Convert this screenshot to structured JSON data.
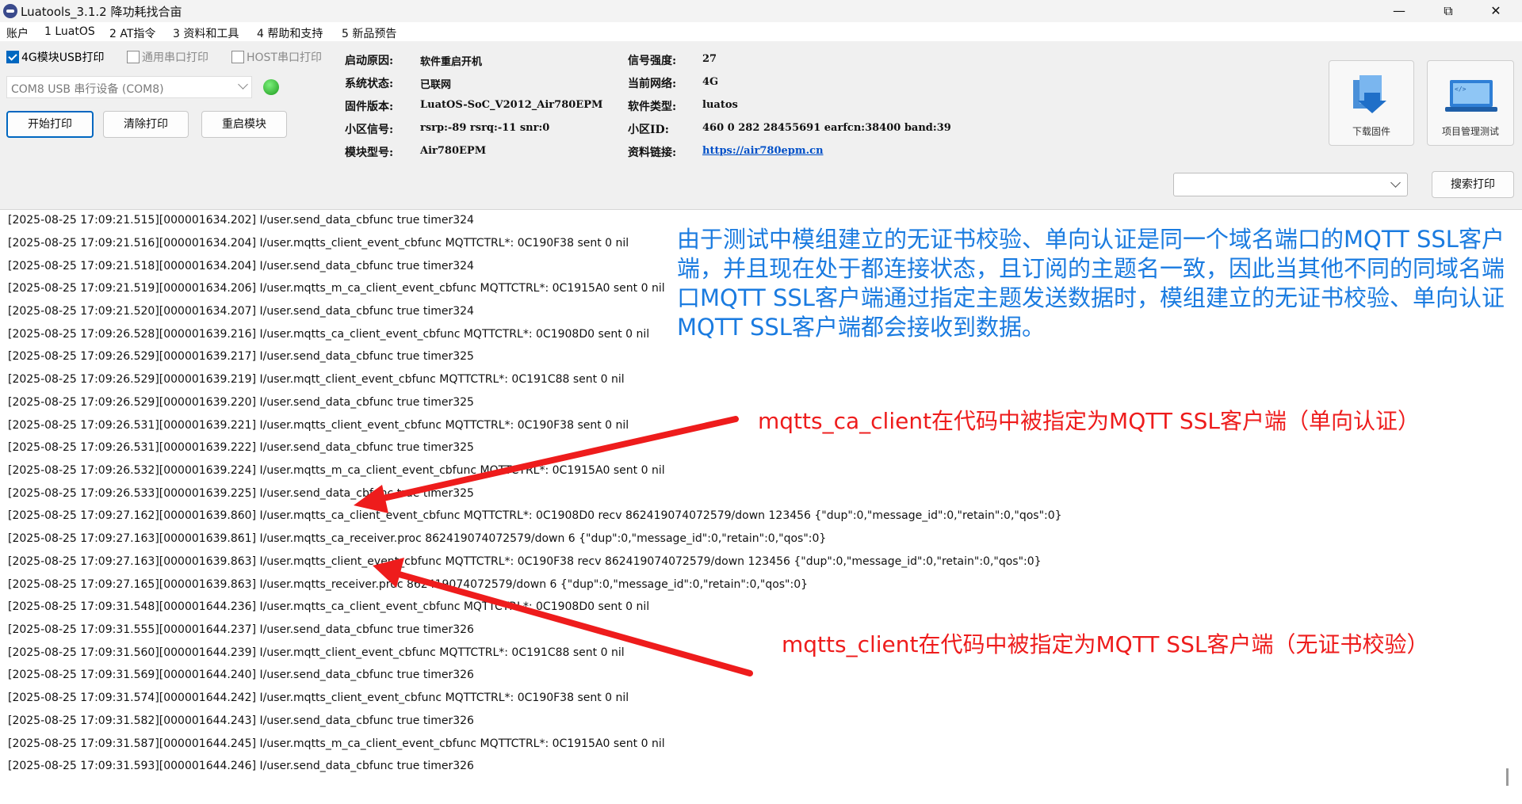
{
  "window": {
    "title": "Luatools_3.1.2 降功耗找合亩",
    "minimize": "—",
    "maximize": "⧉",
    "close": "✕"
  },
  "menu": [
    "账户",
    "1 LuatOS",
    "2 AT指令",
    "3 资料和工具",
    "4 帮助和支持",
    "5 新品预告"
  ],
  "options": {
    "usb_print": {
      "label": "4G模块USB打印",
      "checked": true
    },
    "general_serial": {
      "label": "通用串口打印",
      "checked": false
    },
    "host_serial": {
      "label": "HOST串口打印",
      "checked": false
    }
  },
  "port_select": {
    "value": "COM8 USB 串行设备 (COM8)"
  },
  "buttons": {
    "start": "开始打印",
    "clear": "清除打印",
    "reset": "重启模块",
    "search": "搜索打印"
  },
  "info": {
    "boot_reason": {
      "label": "启动原因:",
      "value": "软件重启开机"
    },
    "sys_status": {
      "label": "系统状态:",
      "value": "已联网"
    },
    "firmware": {
      "label": "固件版本:",
      "value": "LuatOS-SoC_V2012_Air780EPM"
    },
    "cell_signal": {
      "label": "小区信号:",
      "value": "rsrp:-89 rsrq:-11 snr:0"
    },
    "module_model": {
      "label": "模块型号:",
      "value": "Air780EPM"
    },
    "signal_strength": {
      "label": "信号强度:",
      "value": "27"
    },
    "network": {
      "label": "当前网络:",
      "value": "4G"
    },
    "software_type": {
      "label": "软件类型:",
      "value": "luatos"
    },
    "cell_id": {
      "label": "小区ID:",
      "value": "460 0 282 28455691 earfcn:38400 band:39"
    },
    "doc_link": {
      "label": "资料链接:",
      "value": "https://air780epm.cn"
    }
  },
  "tiles": {
    "download": "下载固件",
    "project": "项目管理测试"
  },
  "log_lines": [
    "[2025-08-25 17:09:21.515][000001634.202] I/user.send_data_cbfunc true timer324",
    "[2025-08-25 17:09:21.516][000001634.204] I/user.mqtts_client_event_cbfunc MQTTCTRL*: 0C190F38 sent 0 nil",
    "[2025-08-25 17:09:21.518][000001634.204] I/user.send_data_cbfunc true timer324",
    "[2025-08-25 17:09:21.519][000001634.206] I/user.mqtts_m_ca_client_event_cbfunc MQTTCTRL*: 0C1915A0 sent 0 nil",
    "[2025-08-25 17:09:21.520][000001634.207] I/user.send_data_cbfunc true timer324",
    "[2025-08-25 17:09:26.528][000001639.216] I/user.mqtts_ca_client_event_cbfunc MQTTCTRL*: 0C1908D0 sent 0 nil",
    "[2025-08-25 17:09:26.529][000001639.217] I/user.send_data_cbfunc true timer325",
    "[2025-08-25 17:09:26.529][000001639.219] I/user.mqtt_client_event_cbfunc MQTTCTRL*: 0C191C88 sent 0 nil",
    "[2025-08-25 17:09:26.529][000001639.220] I/user.send_data_cbfunc true timer325",
    "[2025-08-25 17:09:26.531][000001639.221] I/user.mqtts_client_event_cbfunc MQTTCTRL*: 0C190F38 sent 0 nil",
    "[2025-08-25 17:09:26.531][000001639.222] I/user.send_data_cbfunc true timer325",
    "[2025-08-25 17:09:26.532][000001639.224] I/user.mqtts_m_ca_client_event_cbfunc MQTTCTRL*: 0C1915A0 sent 0 nil",
    "[2025-08-25 17:09:26.533][000001639.225] I/user.send_data_cbfunc true timer325",
    "[2025-08-25 17:09:27.162][000001639.860] I/user.mqtts_ca_client_event_cbfunc MQTTCTRL*: 0C1908D0 recv 862419074072579/down 123456 {\"dup\":0,\"message_id\":0,\"retain\":0,\"qos\":0}",
    "[2025-08-25 17:09:27.163][000001639.861] I/user.mqtts_ca_receiver.proc 862419074072579/down 6 {\"dup\":0,\"message_id\":0,\"retain\":0,\"qos\":0}",
    "[2025-08-25 17:09:27.163][000001639.863] I/user.mqtts_client_event_cbfunc MQTTCTRL*: 0C190F38 recv 862419074072579/down 123456 {\"dup\":0,\"message_id\":0,\"retain\":0,\"qos\":0}",
    "[2025-08-25 17:09:27.165][000001639.863] I/user.mqtts_receiver.proc 862419074072579/down 6 {\"dup\":0,\"message_id\":0,\"retain\":0,\"qos\":0}",
    "[2025-08-25 17:09:31.548][000001644.236] I/user.mqtts_ca_client_event_cbfunc MQTTCTRL*: 0C1908D0 sent 0 nil",
    "[2025-08-25 17:09:31.555][000001644.237] I/user.send_data_cbfunc true timer326",
    "[2025-08-25 17:09:31.560][000001644.239] I/user.mqtt_client_event_cbfunc MQTTCTRL*: 0C191C88 sent 0 nil",
    "[2025-08-25 17:09:31.569][000001644.240] I/user.send_data_cbfunc true timer326",
    "[2025-08-25 17:09:31.574][000001644.242] I/user.mqtts_client_event_cbfunc MQTTCTRL*: 0C190F38 sent 0 nil",
    "[2025-08-25 17:09:31.582][000001644.243] I/user.send_data_cbfunc true timer326",
    "[2025-08-25 17:09:31.587][000001644.245] I/user.mqtts_m_ca_client_event_cbfunc MQTTCTRL*: 0C1915A0 sent 0 nil",
    "[2025-08-25 17:09:31.593][000001644.246] I/user.send_data_cbfunc true timer326"
  ],
  "annotations": {
    "blue_note": "由于测试中模组建立的无证书校验、单向认证是同一个域名端口的MQTT SSL客户端，并且现在处于都连接状态，且订阅的主题名一致，因此当其他不同的同域名端口MQTT SSL客户端通过指定主题发送数据时，模组建立的无证书校验、单向认证MQTT SSL客户端都会接收到数据。",
    "ca_client_note": "mqtts_ca_client在代码中被指定为MQTT SSL客户端（单向认证）",
    "client_note": "mqtts_client在代码中被指定为MQTT SSL客户端（无证书校验）"
  },
  "colors": {
    "blue_note": "#1a7be0",
    "red_note": "#ee1c1c",
    "accent": "#0067c0",
    "led": "#2bbf2b"
  },
  "icons": [
    "app-logo-icon",
    "download-firmware-icon",
    "laptop-code-icon",
    "checkbox-checked-icon",
    "chevron-down-icon",
    "status-led-icon"
  ]
}
